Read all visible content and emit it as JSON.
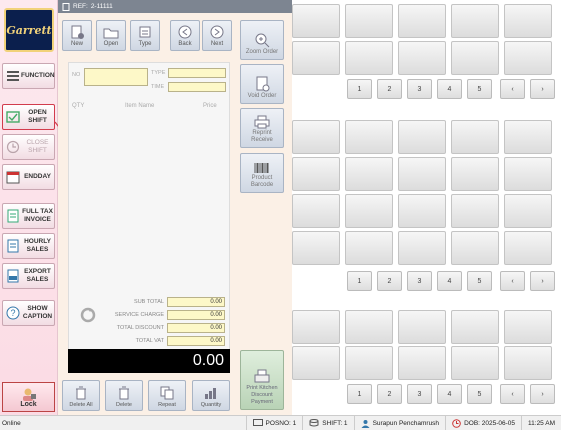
{
  "ref": {
    "label": "REF:",
    "value": "2-11111"
  },
  "logo_text": "Garrett",
  "sidebar": {
    "function": "FUNCTION",
    "open_shift": "OPEN SHIFT",
    "close_shift": "CLOSE SHIFT",
    "endday": "ENDDAY",
    "full_tax_invoice": "FULL TAX INVOICE",
    "hourly_sales": "HOURLY SALES",
    "export_sales": "EXPORT SALES",
    "show_caption": "SHOW CAPTION",
    "lock": "Lock"
  },
  "callout": "1",
  "toolbar": {
    "new": "New",
    "open": "Open",
    "type": "Type",
    "back": "Back",
    "next": "Next"
  },
  "side_actions": {
    "zoom_order": "Zoom Order",
    "void_order": "Void Order",
    "reprint_receive": "Reprint Receive",
    "product_barcode": "Product Barcode",
    "print_kitchen": "Print Kitchen Discount Payment"
  },
  "order": {
    "no_label": "NO",
    "type_label": "TYPE",
    "time_label": "TIME",
    "columns": {
      "qty": "QTY",
      "item_name": "Item Name",
      "price": "Price"
    }
  },
  "totals": {
    "sub_total_label": "SUB TOTAL",
    "sub_total": "0.00",
    "service_charge_label": "SERVICE CHARGE",
    "service_charge": "0.00",
    "total_discount_label": "TOTAL DISCOUNT",
    "total_discount": "0.00",
    "total_vat_label": "TOTAL VAT",
    "total_vat": "0.00",
    "grand_total": "0.00"
  },
  "bottom": {
    "delete_all": "Delete All",
    "delete": "Delete",
    "repeat": "Repeat",
    "quantity": "Quantity"
  },
  "pager": {
    "p1": "1",
    "p2": "2",
    "p3": "3",
    "p4": "4",
    "p5": "5",
    "prev": "‹",
    "next": "›"
  },
  "status": {
    "online": "Online",
    "posno": "POSNO: 1",
    "shift": "SHIFT: 1",
    "user": "Surapun Penchamrush",
    "dob": "DOB: 2025-06-05",
    "time": "11:25 AM"
  },
  "colors": {
    "accent": "#d23b4c",
    "sidebar": "#fbdbe4",
    "field": "#fdf8c8"
  }
}
